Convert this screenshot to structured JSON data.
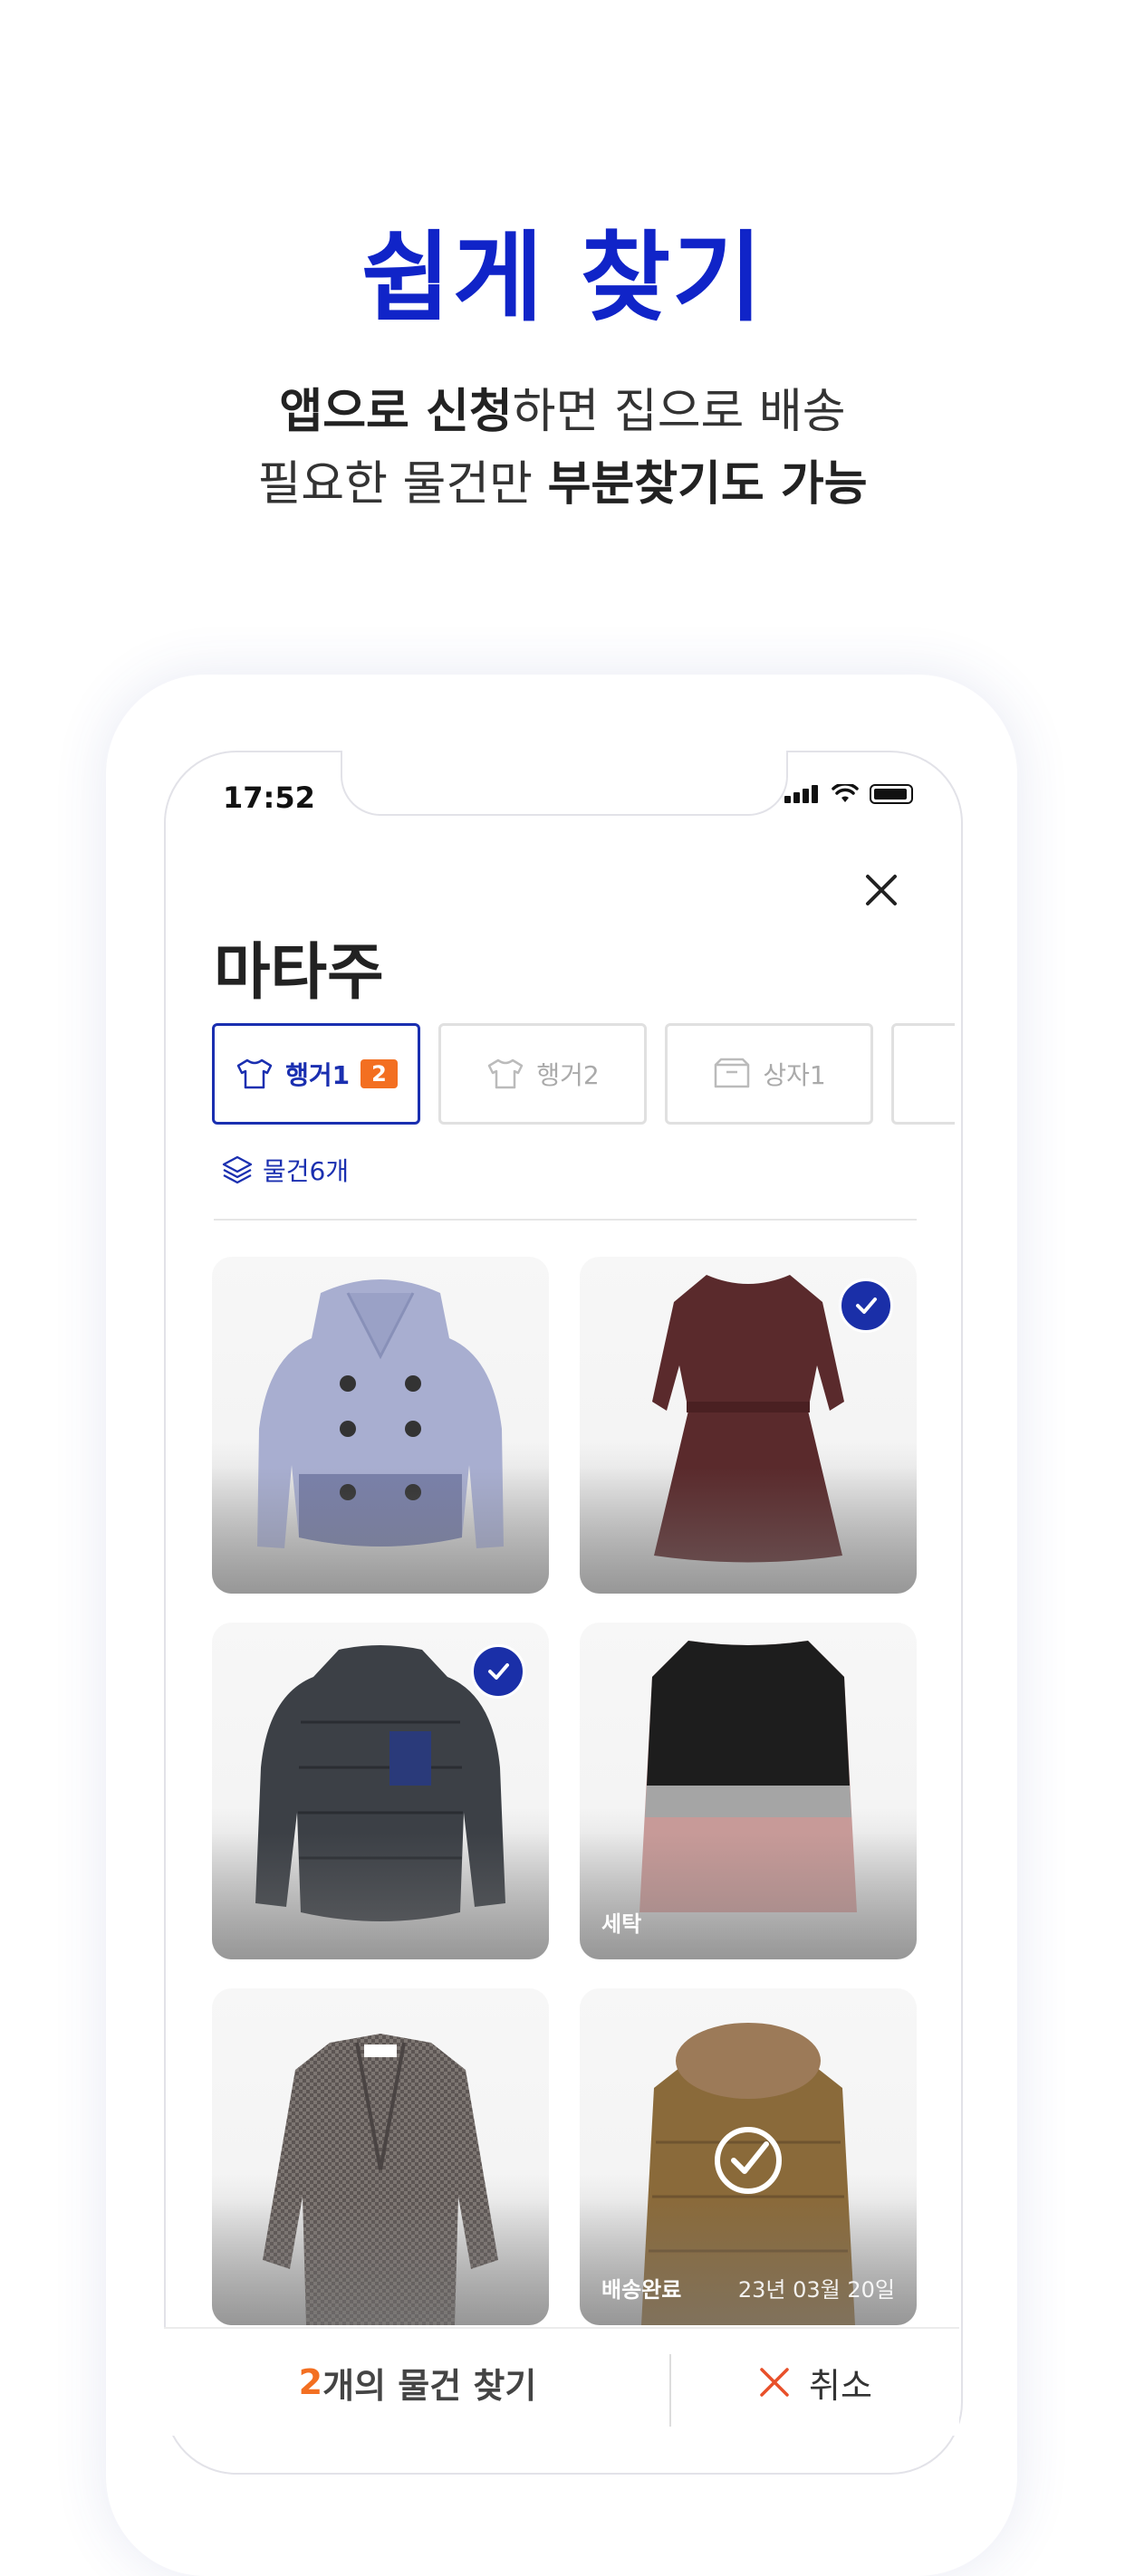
{
  "hero": {
    "title": "쉽게 찾기",
    "line1_bold": "앱으로 신청",
    "line1_rest": "하면 집으로 배송",
    "line2_rest": "필요한 물건만 ",
    "line2_bold": "부분찾기도 가능"
  },
  "status_bar": {
    "time": "17:52"
  },
  "header": {
    "title": "마타주"
  },
  "tabs": [
    {
      "label": "행거1",
      "badge": "2",
      "icon": "shirt-icon",
      "active": true
    },
    {
      "label": "행거2",
      "icon": "shirt-icon",
      "active": false
    },
    {
      "label": "상자1",
      "icon": "box-icon",
      "active": false
    }
  ],
  "item_count": "물건6개",
  "items": [
    {
      "name": "puffer-jacket",
      "selected": false
    },
    {
      "name": "dress",
      "selected": true
    },
    {
      "name": "down-pullover",
      "selected": true
    },
    {
      "name": "fur-coat",
      "selected": false,
      "label": "세탁"
    },
    {
      "name": "check-coat",
      "selected": false
    },
    {
      "name": "parka",
      "selected": false,
      "label": "배송완료",
      "date": "23년 03월 20일",
      "delivered": true
    }
  ],
  "bottom": {
    "find_count": "2",
    "find_text": "개의 물건 찾기",
    "cancel_label": "취소"
  },
  "colors": {
    "accent": "#1024c8",
    "badge": "#f36f21",
    "selected": "#1a2fa8"
  }
}
